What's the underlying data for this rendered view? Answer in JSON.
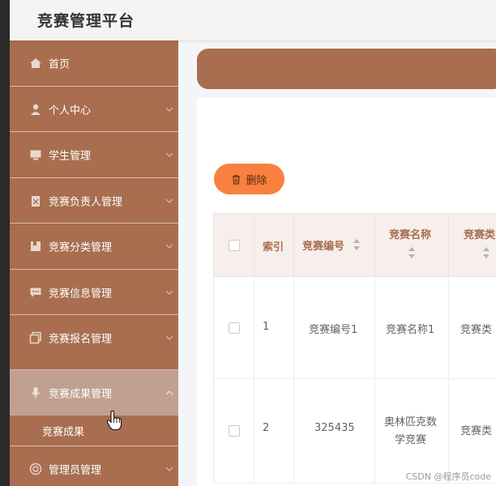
{
  "app": {
    "title": "竞赛管理平台"
  },
  "sidebar": {
    "items": [
      {
        "label": "首页",
        "icon": "home-icon"
      },
      {
        "label": "个人中心",
        "icon": "user-icon"
      },
      {
        "label": "学生管理",
        "icon": "monitor-icon"
      },
      {
        "label": "竞赛负责人管理",
        "icon": "clipboard-icon"
      },
      {
        "label": "竞赛分类管理",
        "icon": "folder-icon"
      },
      {
        "label": "竞赛信息管理",
        "icon": "chat-icon"
      },
      {
        "label": "竞赛报名管理",
        "icon": "copy-icon"
      },
      {
        "label": "竞赛成果管理",
        "icon": "mic-icon"
      },
      {
        "label": "竞赛成果"
      },
      {
        "label": "管理员管理",
        "icon": "target-icon"
      }
    ]
  },
  "toolbar": {
    "delete_label": "删除"
  },
  "table": {
    "headers": [
      "索引",
      "竞赛编号",
      "竞赛名称",
      "竞赛类"
    ],
    "rows": [
      {
        "index": "1",
        "number": "竞赛编号1",
        "name": "竞赛名称1",
        "category": "竞赛类"
      },
      {
        "index": "2",
        "number": "325435",
        "name_line1": "奥林匹克数",
        "name_line2": "学竞赛",
        "category": "竞赛类"
      }
    ]
  },
  "watermark": "CSDN @程序员code",
  "colors": {
    "sidebar": "#a86e4f",
    "active": "#c1a092",
    "delete_button": "#f9803f",
    "header_bg": "#f7efeb"
  }
}
